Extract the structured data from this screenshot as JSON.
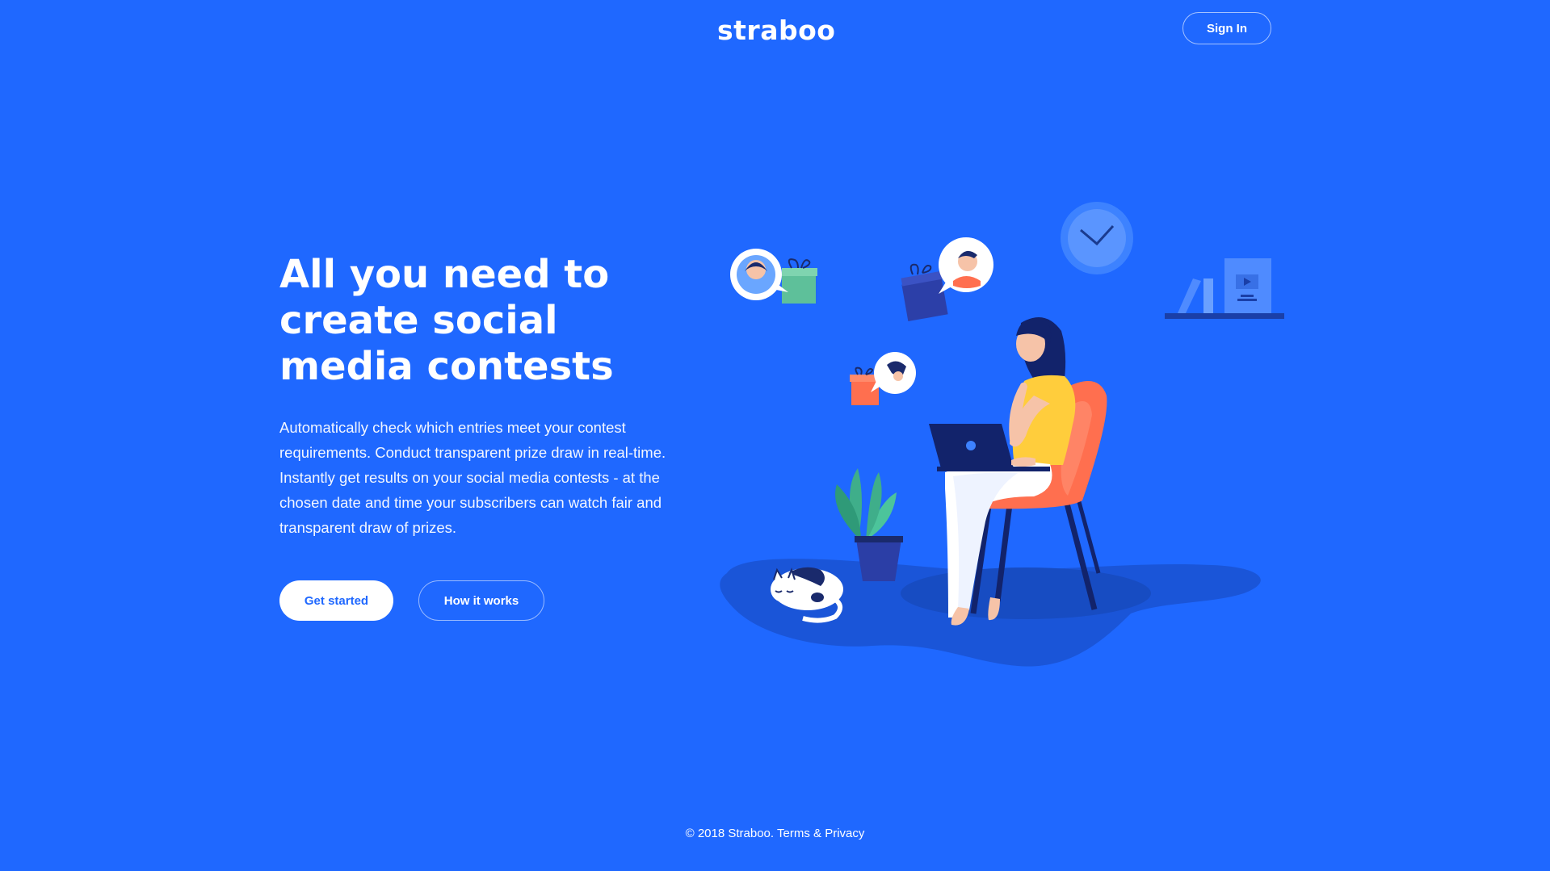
{
  "header": {
    "logo_text": "straboo",
    "signin_label": "Sign In"
  },
  "hero": {
    "title": "All you need to create social media contests",
    "description": "Automatically check which entries meet your contest requirements. Conduct transparent prize draw in real-time. Instantly get results on your social media contests - at the chosen date and time your subscribers can watch fair and transparent draw of prizes.",
    "primary_button": "Get started",
    "secondary_button": "How it works"
  },
  "footer": {
    "copyright": "© 2018 Straboo.",
    "terms_label": "Terms",
    "separator": "&",
    "privacy_label": "Privacy"
  },
  "colors": {
    "background": "#1f68ff",
    "chair": "#ff6f4f",
    "shirt": "#ffcd3c",
    "plant": "#3fae8a",
    "navy": "#1a2a6c"
  }
}
